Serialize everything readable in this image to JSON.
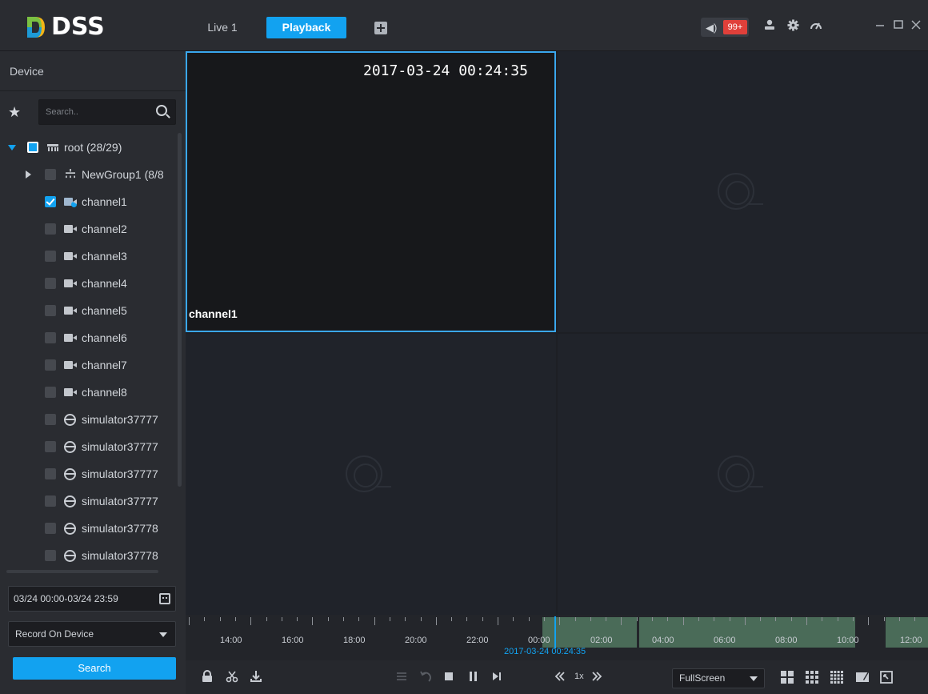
{
  "app": {
    "logo_text": "DSS"
  },
  "tabs": [
    {
      "label": "Live 1"
    },
    {
      "label": "Playback"
    }
  ],
  "header": {
    "alarm_count": "99+"
  },
  "sidebar": {
    "title": "Device",
    "search_placeholder": "Search..",
    "tree": [
      {
        "label": "root (28/29)"
      },
      {
        "label": "NewGroup1 (8/8"
      },
      {
        "label": "channel1"
      },
      {
        "label": "channel2"
      },
      {
        "label": "channel3"
      },
      {
        "label": "channel4"
      },
      {
        "label": "channel5"
      },
      {
        "label": "channel6"
      },
      {
        "label": "channel7"
      },
      {
        "label": "channel8"
      },
      {
        "label": "simulator37777"
      },
      {
        "label": "simulator37777"
      },
      {
        "label": "simulator37777"
      },
      {
        "label": "simulator37777"
      },
      {
        "label": "simulator37778"
      },
      {
        "label": "simulator37778"
      }
    ],
    "date_range": "03/24 00:00-03/24 23:59",
    "record_source": "Record On Device",
    "search_button": "Search"
  },
  "video": {
    "timestamp": "2017-03-24  00:24:35",
    "channel_label": "channel1"
  },
  "timeline": {
    "labels": [
      "14:00",
      "16:00",
      "18:00",
      "20:00",
      "22:00",
      "00:00",
      "02:00",
      "04:00",
      "06:00",
      "08:00",
      "10:00",
      "12:00"
    ],
    "current_time": "2017-03-24 00:24:35"
  },
  "controls": {
    "speed": "1x",
    "view_mode": "FullScreen"
  },
  "colors": {
    "accent": "#12a2f0",
    "record_segment": "#4a6b58",
    "alarm_badge": "#e0403a"
  }
}
